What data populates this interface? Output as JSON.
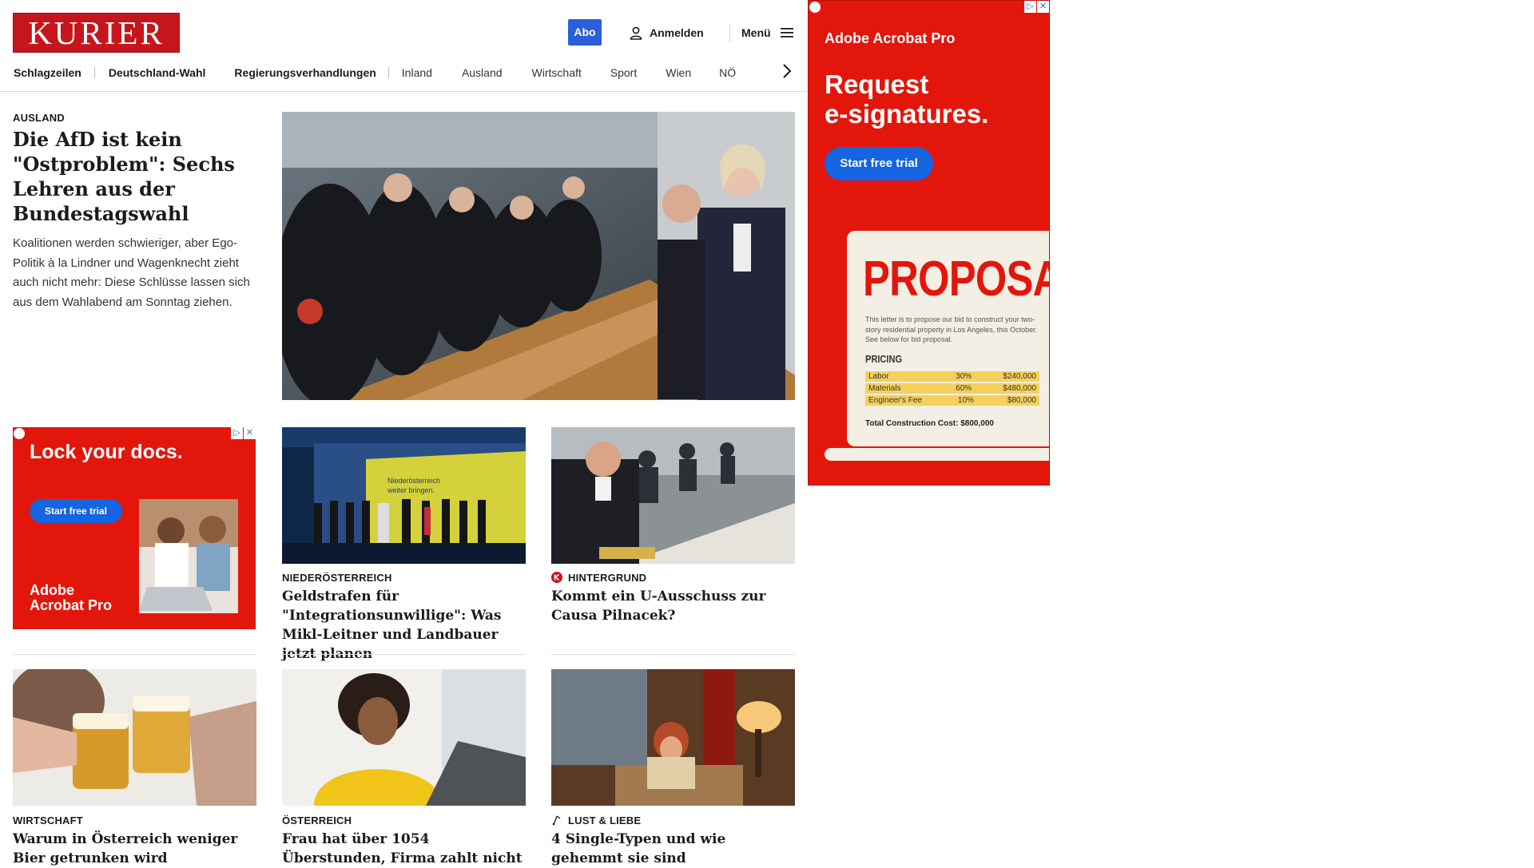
{
  "header": {
    "logo_text": "KURIER",
    "abo_label": "Abo",
    "login_label": "Anmelden",
    "menu_label": "Menü"
  },
  "nav": {
    "items": [
      "Schlagzeilen",
      "Deutschland-Wahl",
      "Regierungsverhandlungen",
      "Inland",
      "Ausland",
      "Wirtschaft",
      "Sport",
      "Wien",
      "NÖ"
    ]
  },
  "lead": {
    "kicker": "AUSLAND",
    "title": "Die AfD ist kein \"Ostproblem\": Sechs Lehren aus der Bundestagswahl",
    "teaser": "Koalitionen werden schwieriger, aber Ego-Politik à la Lindner und Wagenknecht zieht auch nicht mehr: Diese Schlüsse lassen sich aus dem Wahlabend am Sonntag ziehen."
  },
  "ad_small": {
    "headline": "Lock your docs.",
    "cta": "Start free trial",
    "brand_line1": "Adobe",
    "brand_line2": "Acrobat Pro"
  },
  "ad_side": {
    "brand": "Adobe Acrobat Pro",
    "headline_line1": "Request",
    "headline_line2": "e-signatures.",
    "cta": "Start free trial",
    "doc_title": "PROPOSAL",
    "doc_text": "This letter is to propose our bid to construct your two-story residential property in Los Angeles, this October. See below for bid proposal.",
    "pricing_label": "PRICING",
    "rows": [
      {
        "item": "Labor",
        "pct": "30%",
        "amount": "$240,000"
      },
      {
        "item": "Materials",
        "pct": "60%",
        "amount": "$480,000"
      },
      {
        "item": "Engineer's Fee",
        "pct": "10%",
        "amount": "$80,000"
      }
    ],
    "total": "Total Construction Cost: $800,000"
  },
  "articles": [
    {
      "kicker": "NIEDERÖSTERREICH",
      "title": "Geldstrafen für \"Integrationsunwillige\": Was Mikl-Leitner und Landbauer jetzt planen"
    },
    {
      "kicker": "HINTERGRUND",
      "title": "Kommt ein U-Ausschuss zur Causa Pilnacek?"
    },
    {
      "kicker": "WIRTSCHAFT",
      "title": "Warum in Österreich weniger Bier getrunken wird"
    },
    {
      "kicker": "ÖSTERREICH",
      "title": "Frau hat über 1054 Überstunden, Firma zahlt nicht"
    },
    {
      "kicker": "LUST & LIEBE",
      "title": "4 Single-Typen und wie gehemmt sie sind"
    }
  ],
  "image_text": {
    "banner_line1": "Niederösterreich",
    "banner_line2": "weiter bringen."
  },
  "colors": {
    "brand_red": "#c4161c",
    "abo_blue": "#2b5fd9",
    "ad_red": "#e3160b",
    "ad_button": "#1564e1"
  }
}
